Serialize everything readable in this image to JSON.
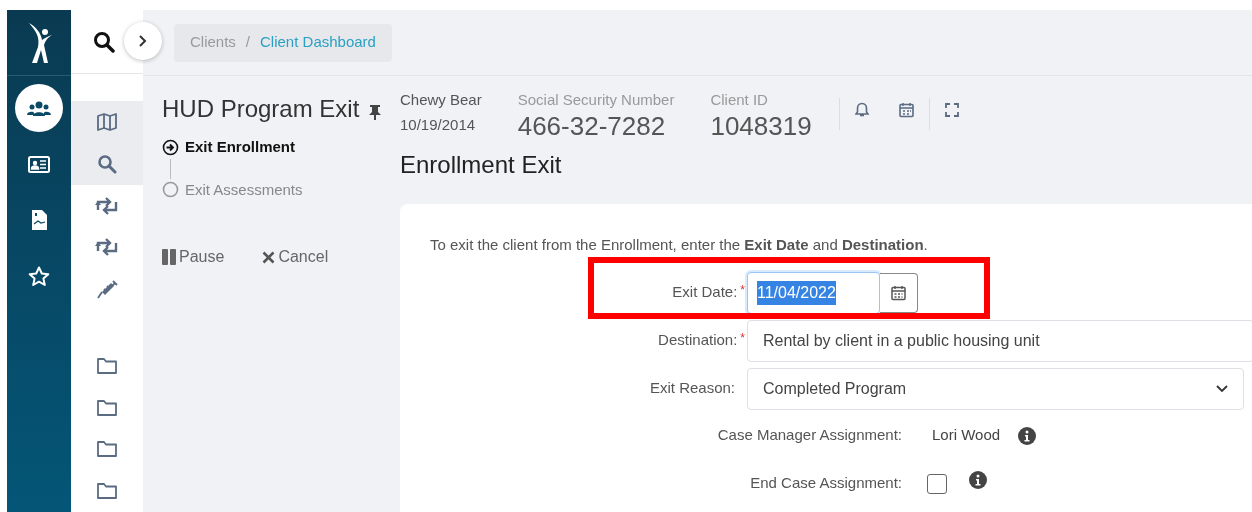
{
  "app_sidebar": {
    "items": [
      {
        "selected": true
      },
      {
        "selected": false
      },
      {
        "selected": false
      },
      {
        "selected": false
      }
    ]
  },
  "tool_sidebar": {
    "items": [
      {
        "kind": "map",
        "selected": true
      },
      {
        "kind": "search",
        "selected": true
      },
      {
        "kind": "repeat",
        "selected": false
      },
      {
        "kind": "repeat",
        "selected": false
      },
      {
        "kind": "syringe",
        "selected": false
      },
      {
        "kind": "gap"
      },
      {
        "kind": "folder",
        "selected": false
      },
      {
        "kind": "folder",
        "selected": false
      },
      {
        "kind": "folder",
        "selected": false
      },
      {
        "kind": "folder",
        "selected": false
      }
    ]
  },
  "breadcrumb": [
    {
      "label": "Clients",
      "kind": "link",
      "current": false
    },
    {
      "label": "/",
      "kind": "separator"
    },
    {
      "label": "Client Dashboard",
      "kind": "link",
      "current": true
    }
  ],
  "workflow": {
    "title": "HUD Program Exit",
    "pinned": true,
    "steps": [
      {
        "label": "Exit Enrollment",
        "current": true
      },
      {
        "label": "Exit Assessments",
        "current": false
      }
    ],
    "actions": [
      {
        "label": "Pause",
        "kind": "pause"
      },
      {
        "label": "Cancel",
        "kind": "cancel"
      }
    ]
  },
  "client": {
    "name": "Chewy Bear",
    "birth_date": "10/19/2014",
    "ssn_label": "Social Security Number",
    "ssn": "466-32-7282",
    "id_label": "Client ID",
    "id": "1048319"
  },
  "page_title": "Enrollment Exit",
  "form": {
    "required_mark": "*",
    "intro": "To exit the client from the Enrollment, enter the **Exit Date** and **Destination**.",
    "fields": [
      {
        "kind": "date",
        "label": "Exit Date:",
        "required": true,
        "value": "11/04/2022",
        "focused": true,
        "text_selected": true
      },
      {
        "kind": "text",
        "label": "Destination:",
        "required": true,
        "value": "Rental by client in a public housing unit"
      },
      {
        "kind": "select",
        "label": "Exit Reason:",
        "required": false,
        "value": "Completed Program"
      },
      {
        "kind": "info",
        "label": "Case Manager Assignment:",
        "value": "Lori Wood"
      },
      {
        "kind": "checkbox",
        "label": "End Case Assignment:",
        "checked": false
      }
    ]
  }
}
